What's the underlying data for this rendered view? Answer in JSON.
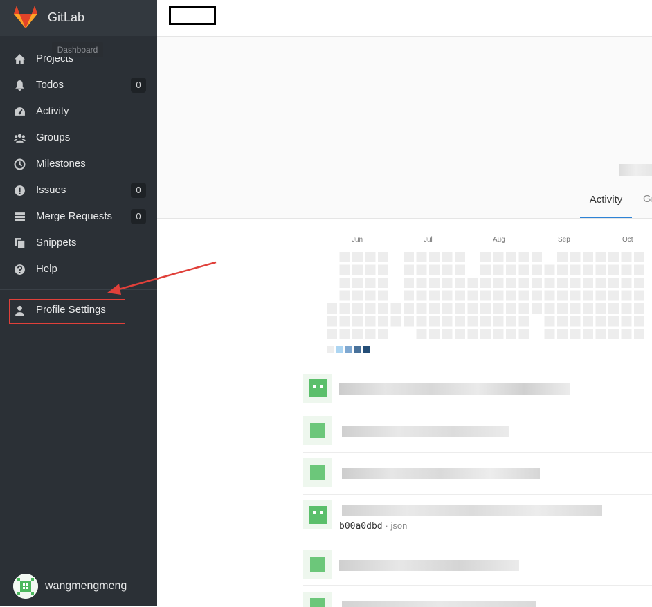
{
  "app": {
    "brand": "GitLab",
    "tooltip": "Dashboard",
    "user_name": "wangmengmeng"
  },
  "sidebar": {
    "items": [
      {
        "label": "Projects",
        "icon": "home-icon"
      },
      {
        "label": "Todos",
        "icon": "bell-icon",
        "badge": "0"
      },
      {
        "label": "Activity",
        "icon": "dashboard-icon"
      },
      {
        "label": "Groups",
        "icon": "group-icon"
      },
      {
        "label": "Milestones",
        "icon": "clock-icon"
      },
      {
        "label": "Issues",
        "icon": "exclamation-icon",
        "badge": "0"
      },
      {
        "label": "Merge Requests",
        "icon": "list-icon",
        "badge": "0"
      },
      {
        "label": "Snippets",
        "icon": "copy-icon"
      },
      {
        "label": "Help",
        "icon": "question-icon"
      }
    ],
    "profile": {
      "label": "Profile Settings",
      "icon": "user-icon"
    }
  },
  "profile": {
    "tabs": {
      "active": "Activity",
      "next": "Gr"
    }
  },
  "calendar": {
    "months": [
      "Jun",
      "Jul",
      "Aug",
      "Sep",
      "Oct"
    ],
    "legend_colors": [
      "#ededed",
      "#acd5f2",
      "#7fa8d1",
      "#49729b",
      "#254e77"
    ]
  },
  "feed": {
    "commit_sha": "b00a0dbd",
    "commit_meta": "· json"
  },
  "colors": {
    "sidebar_bg": "#2b3036",
    "accent": "#2e83d6",
    "annotation": "#e0403a"
  }
}
